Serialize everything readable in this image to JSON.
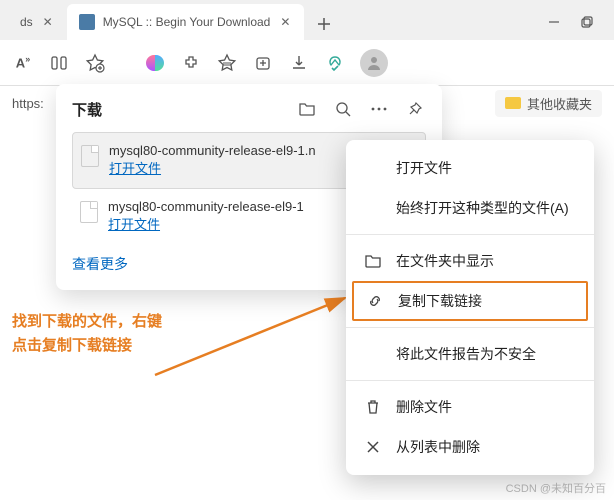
{
  "tabs": {
    "prev_partial": "ds",
    "active": {
      "title": "MySQL :: Begin Your Download"
    }
  },
  "address": {
    "scheme": "https:"
  },
  "favorites": {
    "other_label": "其他收藏夹"
  },
  "downloads": {
    "title": "下载",
    "items": [
      {
        "name": "mysql80-community-release-el9-1.n",
        "action": "打开文件"
      },
      {
        "name": "mysql80-community-release-el9-1",
        "action": "打开文件"
      }
    ],
    "see_more": "查看更多"
  },
  "context_menu": {
    "open_file": "打开文件",
    "always_open_type": "始终打开这种类型的文件(A)",
    "show_in_folder": "在文件夹中显示",
    "copy_link": "复制下载链接",
    "report_unsafe": "将此文件报告为不安全",
    "delete_file": "删除文件",
    "remove_from_list": "从列表中删除"
  },
  "annotation": {
    "line1": "找到下载的文件，右键",
    "line2": "点击复制下载链接"
  },
  "watermark": "CSDN @未知百分百"
}
